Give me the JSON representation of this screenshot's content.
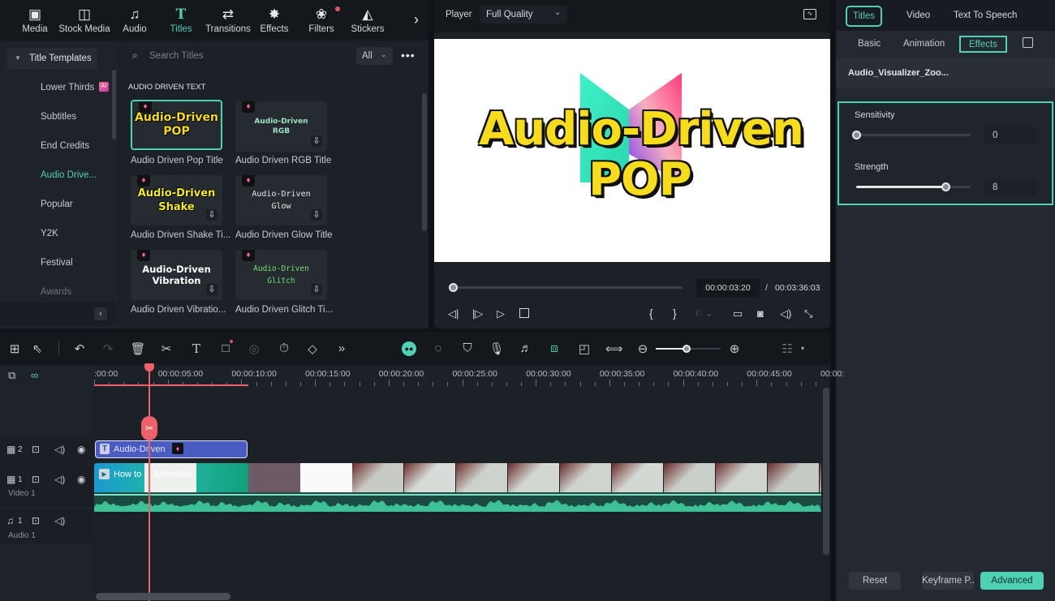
{
  "toolbar": {
    "items": [
      {
        "label": "Media",
        "icon": "media-icon"
      },
      {
        "label": "Stock Media",
        "icon": "stock-media-icon"
      },
      {
        "label": "Audio",
        "icon": "music-note-icon"
      },
      {
        "label": "Titles",
        "icon": "titles-icon",
        "active": true
      },
      {
        "label": "Transitions",
        "icon": "transitions-icon"
      },
      {
        "label": "Effects",
        "icon": "effects-icon"
      },
      {
        "label": "Filters",
        "icon": "filters-icon",
        "badge": true
      },
      {
        "label": "Stickers",
        "icon": "stickers-icon"
      }
    ],
    "more": "›"
  },
  "library": {
    "category_header": "Title Templates",
    "categories": [
      "Lower Thirds",
      "Subtitles",
      "End Credits",
      "Audio Drive...",
      "Popular",
      "Y2K",
      "Festival",
      "Awards"
    ],
    "active_category": "Audio Drive...",
    "lower_thirds_badge": "AI",
    "search_placeholder": "Search Titles",
    "filter_value": "All",
    "section_title": "AUDIO DRIVEN TEXT",
    "templates": [
      {
        "label": "Audio Driven Pop Title",
        "thumb_lines": [
          "Audio-Driven",
          "POP"
        ],
        "selected": true
      },
      {
        "label": "Audio Driven RGB Title",
        "thumb_lines": [
          "Audio-Driven",
          "RGB"
        ]
      },
      {
        "label": "Audio Driven Shake Ti...",
        "thumb_lines": [
          "Audio-Driven",
          "Shake"
        ]
      },
      {
        "label": "Audio Driven Glow Title",
        "thumb_lines": [
          "Audio-Driven",
          "Glow"
        ]
      },
      {
        "label": "Audio Driven Vibratio...",
        "thumb_lines": [
          "Audio-Driven",
          "Vibration"
        ]
      },
      {
        "label": "Audio Driven Glitch Ti...",
        "thumb_lines": [
          "Audio-Driven",
          "Glitch"
        ]
      }
    ]
  },
  "player": {
    "label": "Player",
    "quality": "Full Quality",
    "preview_lines": [
      "Audio-Driven",
      "POP"
    ],
    "current_time": "00:00:03:20",
    "separator": "/",
    "total_time": "00:03:36:03",
    "progress_fraction": 0.015
  },
  "inspector": {
    "tabs": [
      "Titles",
      "Video",
      "Text To Speech"
    ],
    "active_tab": "Titles",
    "subtabs": [
      "Basic",
      "Animation",
      "Effects"
    ],
    "active_subtab": "Effects",
    "effect_name": "Audio_Visualizer_Zoo...",
    "params": [
      {
        "label": "Sensitivity",
        "value": "0",
        "fraction": 0.0
      },
      {
        "label": "Strength",
        "value": "8",
        "fraction": 0.78
      }
    ],
    "buttons": {
      "reset": "Reset",
      "keyframe": "Keyframe P...",
      "advanced": "Advanced"
    }
  },
  "timeline": {
    "ruler": [
      ":00:00",
      "00:00:05:00",
      "00:00:10:00",
      "00:00:15:00",
      "00:00:20:00",
      "00:00:25:00",
      "00:00:30:00",
      "00:00:35:00",
      "00:00:40:00",
      "00:00:45:00",
      "00:00:"
    ],
    "tracks": [
      {
        "number": "2",
        "name": ""
      },
      {
        "number": "1",
        "name": "Video 1"
      },
      {
        "number": "1",
        "name": "Audio 1"
      }
    ],
    "title_clip": "Audio-Driven",
    "video_clip": "How to ... Animation",
    "colors": {
      "accent": "#4fd1b3",
      "playhead": "#f0606a",
      "title_clip": "#4a5bc4"
    }
  }
}
